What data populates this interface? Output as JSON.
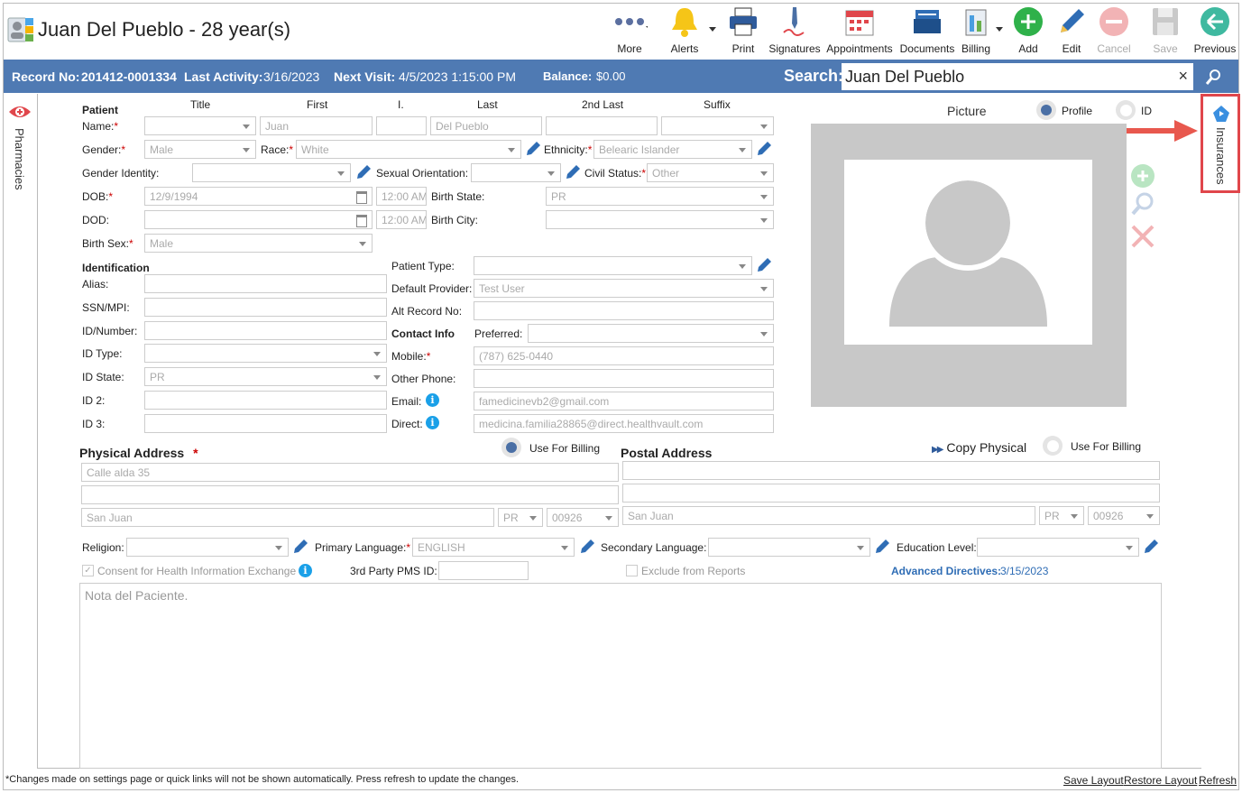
{
  "header": {
    "title": "Juan Del Pueblo - 28 year(s)"
  },
  "toolbar": [
    {
      "name": "more",
      "label": "More"
    },
    {
      "name": "alerts",
      "label": "Alerts"
    },
    {
      "name": "print",
      "label": "Print"
    },
    {
      "name": "signatures",
      "label": "Signatures"
    },
    {
      "name": "appointments",
      "label": "Appointments"
    },
    {
      "name": "documents",
      "label": "Documents"
    },
    {
      "name": "billing",
      "label": "Billing"
    },
    {
      "name": "add",
      "label": "Add"
    },
    {
      "name": "edit",
      "label": "Edit"
    },
    {
      "name": "cancel",
      "label": "Cancel"
    },
    {
      "name": "save",
      "label": "Save"
    },
    {
      "name": "previous",
      "label": "Previous"
    }
  ],
  "infobar": {
    "record_label": "Record No:",
    "record_value": "201412-0001334",
    "activity_label": "Last Activity:",
    "activity_value": "3/16/2023",
    "visit_label": "Next Visit:",
    "visit_value": "4/5/2023 1:15:00 PM",
    "balance_label": "Balance:",
    "balance_value": "$0.00",
    "search_label": "Search:",
    "search_value": "Juan Del Pueblo",
    "clear": "×"
  },
  "side": {
    "left_tab": "Pharmacies",
    "right_tab": "Insurances"
  },
  "patient": {
    "section": "Patient",
    "cols": {
      "title": "Title",
      "first": "First",
      "initial": "I.",
      "last": "Last",
      "second_last": "2nd Last",
      "suffix": "Suffix"
    },
    "name_label": "Name:",
    "first_value": "Juan",
    "last_value": "Del Pueblo",
    "gender_label": "Gender:",
    "gender_value": "Male",
    "race_label": "Race:",
    "race_value": "White",
    "ethnicity_label": "Ethnicity:",
    "ethnicity_value": "Belearic Islander",
    "gender_identity_label": "Gender Identity:",
    "sexual_orientation_label": "Sexual Orientation:",
    "civil_status_label": "Civil Status:",
    "civil_status_value": "Other",
    "dob_label": "DOB:",
    "dob_value": "12/9/1994",
    "dob_time": "12:00 AM",
    "birth_state_label": "Birth State:",
    "birth_state_value": "PR",
    "dod_label": "DOD:",
    "dod_time": "12:00 AM",
    "birth_city_label": "Birth City:",
    "birth_sex_label": "Birth Sex:",
    "birth_sex_value": "Male"
  },
  "identification": {
    "section": "Identification",
    "alias_label": "Alias:",
    "ssn_label": "SSN/MPI:",
    "idnum_label": "ID/Number:",
    "idtype_label": "ID Type:",
    "idstate_label": "ID State:",
    "idstate_value": "PR",
    "id2_label": "ID 2:",
    "id3_label": "ID 3:"
  },
  "other": {
    "patient_type_label": "Patient Type:",
    "default_provider_label": "Default Provider:",
    "default_provider_value": "Test User",
    "alt_record_label": "Alt Record No:"
  },
  "contact": {
    "section": "Contact Info",
    "preferred_label": "Preferred:",
    "mobile_label": "Mobile:",
    "mobile_value": "(787) 625-0440",
    "other_phone_label": "Other Phone:",
    "email_label": "Email:",
    "email_value": "famedicinevb2@gmail.com",
    "direct_label": "Direct:",
    "direct_value": "medicina.familia28865@direct.healthvault.com",
    "info_glyph": "i"
  },
  "picture": {
    "label": "Picture",
    "profile_label": "Profile",
    "id_label": "ID"
  },
  "physical": {
    "title": "Physical Address",
    "req": "*",
    "use_billing": "Use For Billing",
    "line1": "Calle alda 35",
    "line2": "",
    "city": "San Juan",
    "state": "PR",
    "zip": "00926"
  },
  "postal": {
    "title": "Postal Address",
    "copy": "Copy Physical",
    "copy_glyph": "▶▶",
    "use_billing": "Use For Billing",
    "line1": "",
    "line2": "",
    "city": "San Juan",
    "state": "PR",
    "zip": "00926"
  },
  "misc": {
    "religion_label": "Religion:",
    "primary_language_label": "Primary Language:",
    "primary_language_value": "ENGLISH",
    "secondary_language_label": "Secondary Language:",
    "education_label": "Education Level:",
    "consent_label": "Consent for Health Information Exchange",
    "third_party_label": "3rd Party PMS ID:",
    "exclude_label": "Exclude from Reports",
    "advanced_label": "Advanced Directives:",
    "advanced_value": "3/15/2023",
    "note_placeholder": "Nota del Paciente."
  },
  "footer": {
    "notice": "*Changes made on settings page or quick links will not be shown automatically. Press refresh to update the changes.",
    "save_layout": "Save Layout",
    "restore_layout": "Restore Layout",
    "refresh": "Refresh"
  },
  "colors": {
    "accent": "#4f7ab3",
    "highlight": "#e0464b",
    "add": "#2fb14a",
    "previous": "#3fb9a0"
  }
}
